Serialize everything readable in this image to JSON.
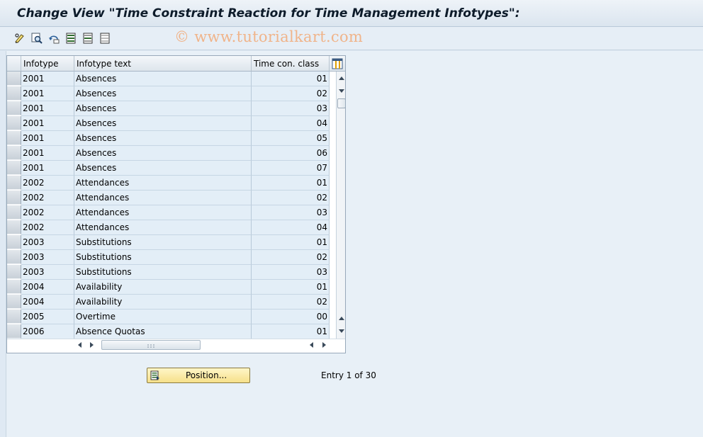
{
  "window": {
    "title": "Change View \"Time Constraint Reaction for Time Management Infotypes\":",
    "watermark": "© www.tutorialkart.com"
  },
  "toolbar": {
    "buttons": [
      {
        "icon": "display-change-icon"
      },
      {
        "icon": "find-icon"
      },
      {
        "icon": "undo-icon"
      },
      {
        "icon": "select-all-icon"
      },
      {
        "icon": "select-block-icon"
      },
      {
        "icon": "deselect-all-icon"
      }
    ]
  },
  "table": {
    "columns": [
      "Infotype",
      "Infotype text",
      "Time con. class"
    ],
    "column_settings_icon": "table-settings-icon",
    "rows": [
      {
        "infotype": "2001",
        "text": "Absences",
        "class": "01"
      },
      {
        "infotype": "2001",
        "text": "Absences",
        "class": "02"
      },
      {
        "infotype": "2001",
        "text": "Absences",
        "class": "03"
      },
      {
        "infotype": "2001",
        "text": "Absences",
        "class": "04"
      },
      {
        "infotype": "2001",
        "text": "Absences",
        "class": "05"
      },
      {
        "infotype": "2001",
        "text": "Absences",
        "class": "06"
      },
      {
        "infotype": "2001",
        "text": "Absences",
        "class": "07"
      },
      {
        "infotype": "2002",
        "text": "Attendances",
        "class": "01"
      },
      {
        "infotype": "2002",
        "text": "Attendances",
        "class": "02"
      },
      {
        "infotype": "2002",
        "text": "Attendances",
        "class": "03"
      },
      {
        "infotype": "2002",
        "text": "Attendances",
        "class": "04"
      },
      {
        "infotype": "2003",
        "text": "Substitutions",
        "class": "01"
      },
      {
        "infotype": "2003",
        "text": "Substitutions",
        "class": "02"
      },
      {
        "infotype": "2003",
        "text": "Substitutions",
        "class": "03"
      },
      {
        "infotype": "2004",
        "text": "Availability",
        "class": "01"
      },
      {
        "infotype": "2004",
        "text": "Availability",
        "class": "02"
      },
      {
        "infotype": "2005",
        "text": "Overtime",
        "class": "00"
      },
      {
        "infotype": "2006",
        "text": "Absence Quotas",
        "class": "01"
      }
    ]
  },
  "footer": {
    "position_button": "Position...",
    "entry_text": "Entry 1 of 30"
  },
  "colors": {
    "background": "#dfe9f3",
    "cell": "#e3eef7",
    "button": "#f6e08a"
  }
}
